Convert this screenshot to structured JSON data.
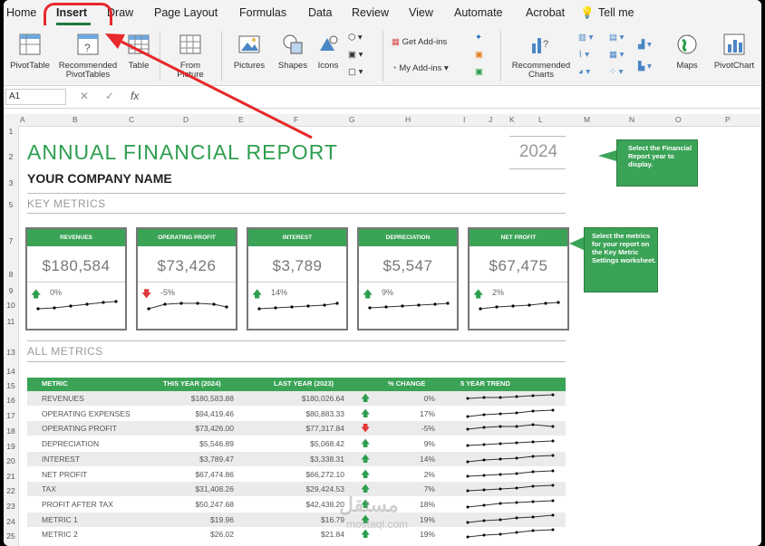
{
  "tabs": [
    "Home",
    "Insert",
    "Draw",
    "Page Layout",
    "Formulas",
    "Data",
    "Review",
    "View",
    "Automate",
    "Acrobat",
    "Tell me"
  ],
  "ribbon": {
    "pivottable": "PivotTable",
    "recommended_pivot": [
      "Recommended",
      "PivotTables"
    ],
    "table": "Table",
    "from_picture": [
      "From",
      "Picture"
    ],
    "pictures": "Pictures",
    "shapes": "Shapes",
    "icons": "Icons",
    "get_addins": "Get Add-ins",
    "my_addins": "My Add-ins",
    "recommended_charts": [
      "Recommended",
      "Charts"
    ],
    "maps": "Maps",
    "pivotchart": "PivotChart"
  },
  "formula_bar": {
    "name_box": "A1",
    "fx": "fx"
  },
  "columns": [
    "A",
    "B",
    "C",
    "D",
    "E",
    "F",
    "G",
    "H",
    "I",
    "J",
    "K",
    "L",
    "M",
    "N",
    "O",
    "P"
  ],
  "rows": [
    "1",
    "2",
    "3",
    "5",
    "7",
    "8",
    "9",
    "10",
    "11",
    "13",
    "14",
    "15",
    "16",
    "17",
    "18",
    "19",
    "20",
    "21",
    "22",
    "23",
    "24",
    "25"
  ],
  "sheet": {
    "title": "ANNUAL FINANCIAL REPORT",
    "company": "YOUR COMPANY NAME",
    "key_metrics": "KEY METRICS",
    "all_metrics": "ALL METRICS",
    "year": "2024",
    "callout_year": "Select the Financial Report year to display.",
    "callout_metrics": "Select the metrics for your report on the Key Metric Settings worksheet."
  },
  "cards": [
    {
      "header": "REVENUES",
      "value": "$180,584",
      "pct": "0%",
      "dir": "up"
    },
    {
      "header": "OPERATING PROFIT",
      "value": "$73,426",
      "pct": "-5%",
      "dir": "down"
    },
    {
      "header": "INTEREST",
      "value": "$3,789",
      "pct": "14%",
      "dir": "up"
    },
    {
      "header": "DEPRECIATION",
      "value": "$5,547",
      "pct": "9%",
      "dir": "up"
    },
    {
      "header": "NET PROFIT",
      "value": "$67,475",
      "pct": "2%",
      "dir": "up"
    }
  ],
  "table": {
    "headers": [
      "METRIC",
      "THIS YEAR (2024)",
      "LAST YEAR (2023)",
      "% CHANGE",
      "5 YEAR TREND"
    ],
    "rows": [
      {
        "metric": "REVENUES",
        "this": "$180,583.88",
        "last": "$180,026.64",
        "dir": "up",
        "pct": "0%"
      },
      {
        "metric": "OPERATING EXPENSES",
        "this": "$94,419.46",
        "last": "$80,883.33",
        "dir": "up",
        "pct": "17%"
      },
      {
        "metric": "OPERATING PROFIT",
        "this": "$73,426.00",
        "last": "$77,317.84",
        "dir": "down",
        "pct": "-5%"
      },
      {
        "metric": "DEPRECIATION",
        "this": "$5,546.89",
        "last": "$5,068.42",
        "dir": "up",
        "pct": "9%"
      },
      {
        "metric": "INTEREST",
        "this": "$3,789.47",
        "last": "$3,338.31",
        "dir": "up",
        "pct": "14%"
      },
      {
        "metric": "NET PROFIT",
        "this": "$67,474.86",
        "last": "$66,272.10",
        "dir": "up",
        "pct": "2%"
      },
      {
        "metric": "TAX",
        "this": "$31,408.26",
        "last": "$29,424.53",
        "dir": "up",
        "pct": "7%"
      },
      {
        "metric": "PROFIT AFTER TAX",
        "this": "$50,247.68",
        "last": "$42,438.20",
        "dir": "up",
        "pct": "18%"
      },
      {
        "metric": "METRIC 1",
        "this": "$19.96",
        "last": "$16.79",
        "dir": "up",
        "pct": "19%"
      },
      {
        "metric": "METRIC 2",
        "this": "$26.02",
        "last": "$21.84",
        "dir": "up",
        "pct": "19%"
      }
    ]
  },
  "watermark": {
    "arabic": "مستقل",
    "latin": "mostaql.com"
  },
  "colors": {
    "accent": "#3aa356",
    "arrow_up": "#2e9e4f",
    "arrow_down": "#e0383a",
    "highlight": "#e8282b"
  }
}
